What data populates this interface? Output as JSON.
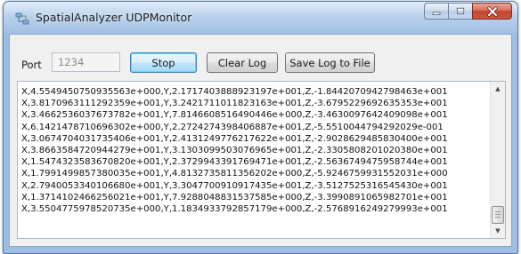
{
  "window": {
    "title": "SpatialAnalyzer UDPMonitor"
  },
  "toolbar": {
    "port_label": "Port",
    "port_value": "1234",
    "stop_label": "Stop",
    "clear_label": "Clear Log",
    "save_label": "Save Log to File"
  },
  "log": {
    "lines": [
      "X,4.5549450750935563e+000,Y,2.1717403888923197e+001,Z,-1.8442070942798463e+001",
      "X,3.8170963111292359e+001,Y,3.2421711011823163e+001,Z,-3.6795229692635353e+001",
      "X,3.4662536037673782e+001,Y,7.8146608516490446e+000,Z,-3.4630097642409098e+001",
      "X,6.1421478710696302e+000,Y,2.2724274398406887e+001,Z,-5.5510044794292029e-001",
      "X,3.0674704031735406e+001,Y,2.4131249776217622e+001,Z,-2.9028629485830400e+001",
      "X,3.8663584720944279e+001,Y,3.1303099503076965e+001,Z,-2.3305808201020380e+001",
      "X,1.5474323583670820e+001,Y,2.3729943391769471e+001,Z,-2.5636749475958744e+001",
      "X,1.7991499857380035e+001,Y,4.8132735811356202e+000,Z,-5.9246759931552031e+000",
      "X,2.7940053340106680e+001,Y,3.3047700910917435e+001,Z,-3.5127525316545430e+001",
      "X,1.3714102466256021e+001,Y,7.9288048831537585e+000,Z,-3.3990891065982701e+001",
      "X,3.5504775978520735e+000,Y,1.1834933792857179e+000,Z,-2.5768916249279993e+001"
    ]
  },
  "icons": {
    "app": "network-adapter-icon",
    "minimize": "minimize-icon",
    "maximize": "maximize-icon",
    "close": "close-icon",
    "scroll_up": "scroll-up-arrow-icon",
    "scroll_down": "scroll-down-arrow-icon"
  },
  "colors": {
    "title_bar": "#a7c4e6",
    "close_button": "#c2462d",
    "active_button": "#bee6fd"
  }
}
